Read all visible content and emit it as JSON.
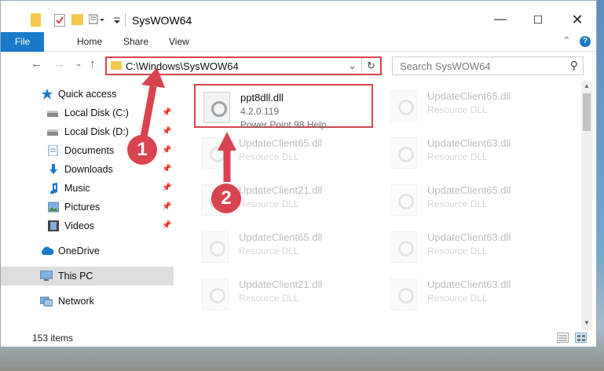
{
  "window": {
    "title": "SysWOW64"
  },
  "ribbon": {
    "file_tab": "File",
    "tabs": [
      "Home",
      "Share",
      "View"
    ],
    "help": "?"
  },
  "nav": {
    "address": "C:\\Windows\\SysWOW64",
    "search_placeholder": "Search SysWOW64"
  },
  "sidebar": {
    "items": [
      {
        "label": "Quick access",
        "icon": "star-icon",
        "pinned": false
      },
      {
        "label": "Local Disk (C:)",
        "icon": "drive-icon",
        "pinned": true
      },
      {
        "label": "Local Disk (D:)",
        "icon": "drive-icon",
        "pinned": true
      },
      {
        "label": "Documents",
        "icon": "documents-icon",
        "pinned": true
      },
      {
        "label": "Downloads",
        "icon": "download-icon",
        "pinned": true
      },
      {
        "label": "Music",
        "icon": "music-icon",
        "pinned": true
      },
      {
        "label": "Pictures",
        "icon": "pictures-icon",
        "pinned": true
      },
      {
        "label": "Videos",
        "icon": "videos-icon",
        "pinned": true
      },
      {
        "label": "OneDrive",
        "icon": "cloud-icon",
        "pinned": false
      },
      {
        "label": "This PC",
        "icon": "computer-icon",
        "pinned": false,
        "selected": true
      },
      {
        "label": "Network",
        "icon": "network-icon",
        "pinned": false
      }
    ]
  },
  "files": [
    {
      "name": "ppt8dll.dll",
      "line2": "4.2.0.119",
      "line3": "Power Point 98 Help...",
      "highlighted": true
    },
    {
      "name": "UpdateClient65.dll",
      "line2": "Resource DLL"
    },
    {
      "name": "UpdateClient65.dll",
      "line2": "Resource DLL"
    },
    {
      "name": "UpdateClient63.dll",
      "line2": "Resource DLL"
    },
    {
      "name": "UpdateClient21.dll",
      "line2": "Resource DLL"
    },
    {
      "name": "UpdateClient65.dll",
      "line2": "Resource DLL"
    },
    {
      "name": "UpdateClient65.dll",
      "line2": "Resource DLL"
    },
    {
      "name": "UpdateClient63.dll",
      "line2": "Resource DLL"
    },
    {
      "name": "UpdateClient21.dll",
      "line2": "Resource DLL"
    },
    {
      "name": "UpdateClient63.dll",
      "line2": "Resource DLL"
    }
  ],
  "status": {
    "items_count": "153 items"
  },
  "annotations": {
    "step1": "1",
    "step2": "2"
  },
  "colors": {
    "accent": "#1979ca",
    "highlight": "#d9434e",
    "folder": "#f2c94c"
  }
}
